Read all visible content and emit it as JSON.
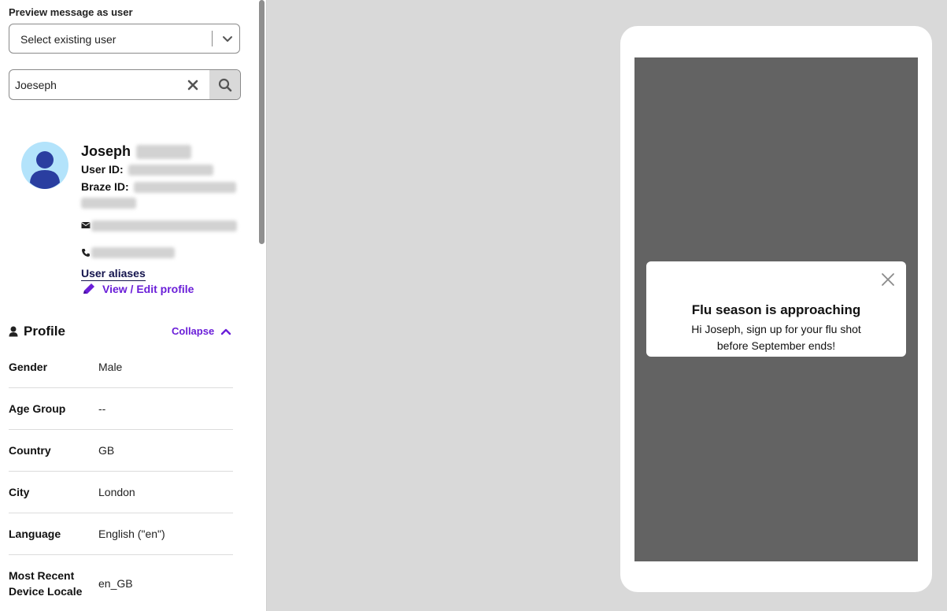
{
  "preview": {
    "label": "Preview message as user",
    "select_placeholder": "Select existing user",
    "search_value": "Joeseph"
  },
  "user": {
    "first_name": "Joseph",
    "user_id_label": "User ID:",
    "braze_id_label": "Braze ID:",
    "aliases_label": "User aliases",
    "edit_label": "View / Edit profile"
  },
  "profile": {
    "title": "Profile",
    "collapse_label": "Collapse",
    "rows": [
      {
        "label": "Gender",
        "value": "Male"
      },
      {
        "label": "Age Group",
        "value": "--"
      },
      {
        "label": "Country",
        "value": "GB"
      },
      {
        "label": "City",
        "value": "London"
      },
      {
        "label": "Language",
        "value": "English (\"en\")"
      },
      {
        "label": "Most Recent Device Locale",
        "value": "en_GB"
      }
    ]
  },
  "message": {
    "title": "Flu season is approaching",
    "body": "Hi Joseph, sign up for your flu shot before September ends!"
  },
  "colors": {
    "accent": "#6a1ed8",
    "avatar_bg": "#b3e3fb",
    "avatar_fg": "#2a3ea0",
    "screen_bg": "#636363",
    "canvas_bg": "#d9d9d9"
  }
}
